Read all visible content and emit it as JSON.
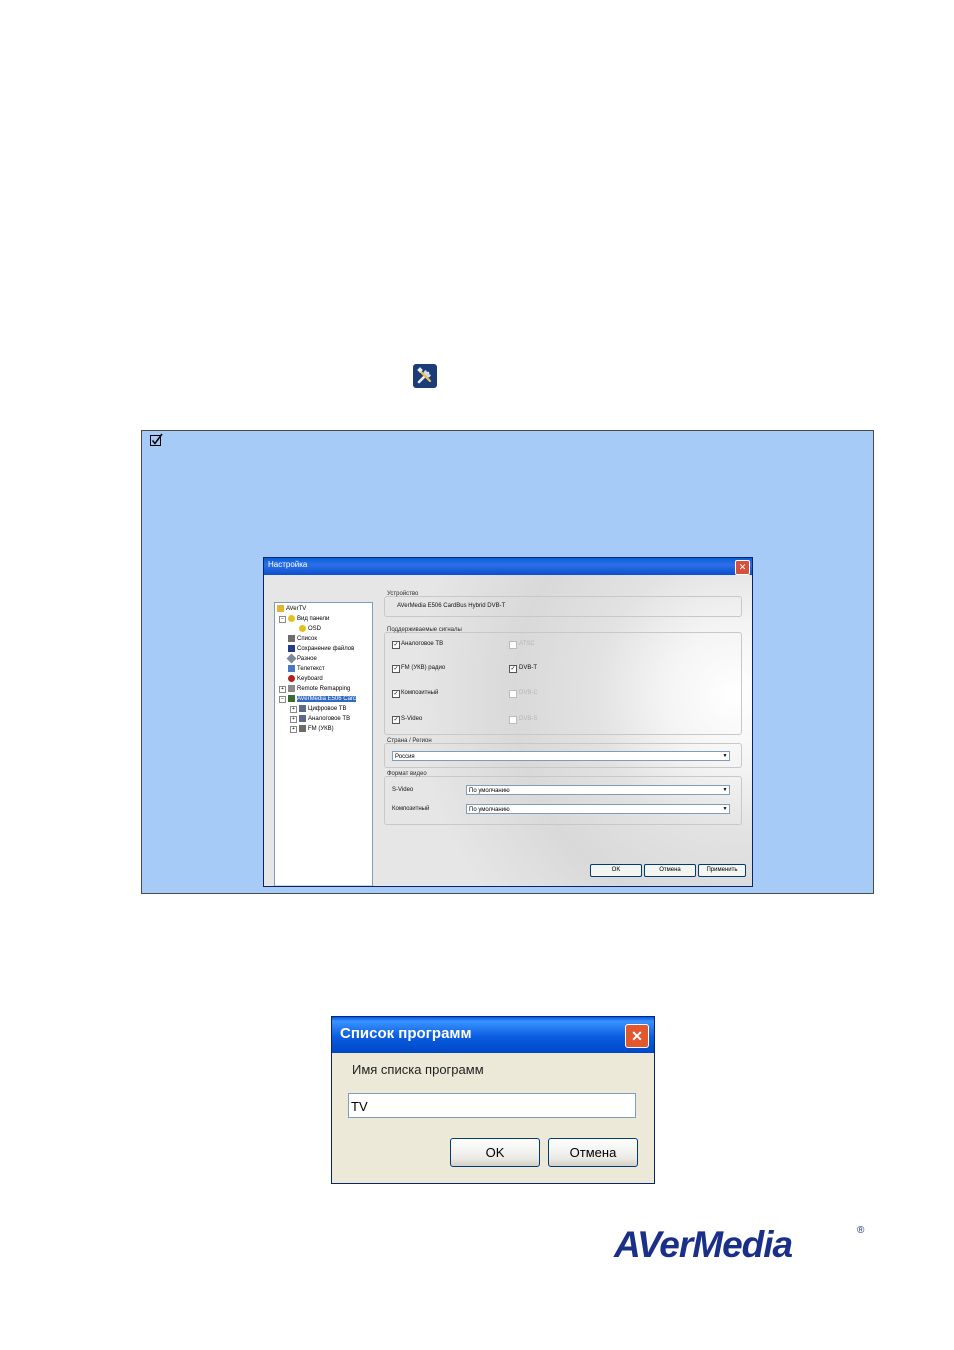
{
  "settings_dialog": {
    "title": "Настройка",
    "close_glyph": "✕",
    "tree": [
      {
        "label": "AVerTV",
        "icon": "folder-icon"
      },
      {
        "label": "Вид панели",
        "icon": "panel-icon"
      },
      {
        "label": "OSD",
        "icon": "osd-icon"
      },
      {
        "label": "Список",
        "icon": "list-icon"
      },
      {
        "label": "Сохранение файлов",
        "icon": "save-icon"
      },
      {
        "label": "Разное",
        "icon": "misc-icon"
      },
      {
        "label": "Телетекст",
        "icon": "teletext-icon"
      },
      {
        "label": "Keyboard",
        "icon": "keyboard-icon"
      },
      {
        "label": "Remote Remapping",
        "icon": "remote-icon"
      },
      {
        "label": "AVerMedia E506 Carc",
        "icon": "card-icon"
      },
      {
        "label": "Цифровое ТВ",
        "icon": "digital-tv-icon"
      },
      {
        "label": "Аналоговое ТВ",
        "icon": "analog-tv-icon"
      },
      {
        "label": "FM (УКВ)",
        "icon": "radio-icon"
      }
    ],
    "device_group": {
      "label": "Устройство",
      "value": "AVerMedia E506 CardBus Hybrid DVB-T"
    },
    "signals_group": {
      "label": "Поддерживаемые сигналы",
      "items": [
        {
          "label": "Аналоговое ТВ",
          "checked": true,
          "enabled": true
        },
        {
          "label": "ATSC",
          "checked": false,
          "enabled": false
        },
        {
          "label": "FM (УКВ) радио",
          "checked": true,
          "enabled": true
        },
        {
          "label": "DVB-T",
          "checked": true,
          "enabled": true
        },
        {
          "label": "Композитный",
          "checked": true,
          "enabled": true
        },
        {
          "label": "DVB-C",
          "checked": false,
          "enabled": false
        },
        {
          "label": "S-Video",
          "checked": true,
          "enabled": true
        },
        {
          "label": "DVB-S",
          "checked": false,
          "enabled": false
        }
      ]
    },
    "region_group": {
      "label": "Страна / Регион",
      "value": "Россия"
    },
    "video_format_group": {
      "label": "Формат видео",
      "svideo_label": "S-Video",
      "svideo_value": "По умолчанию",
      "composite_label": "Композитный",
      "composite_value": "По умолчанию"
    },
    "buttons": {
      "ok": "OK",
      "cancel": "Отмена",
      "apply": "Применить"
    },
    "checkmark": "✓",
    "arrow": "▼",
    "scroll_left": "<",
    "scroll_right": ">"
  },
  "note": {
    "check_glyph": "☑"
  },
  "program_dialog": {
    "title": "Список программ",
    "close_glyph": "✕",
    "label": "Имя списка программ",
    "input_value": "TV",
    "ok": "OK",
    "cancel": "Отмена"
  },
  "logo": {
    "text": "AVerMedia",
    "reg": "®"
  },
  "colors": {
    "note_bg": "#a6cbf7",
    "title_blue": "#0a5fd8",
    "logo": "#1a2f88"
  }
}
